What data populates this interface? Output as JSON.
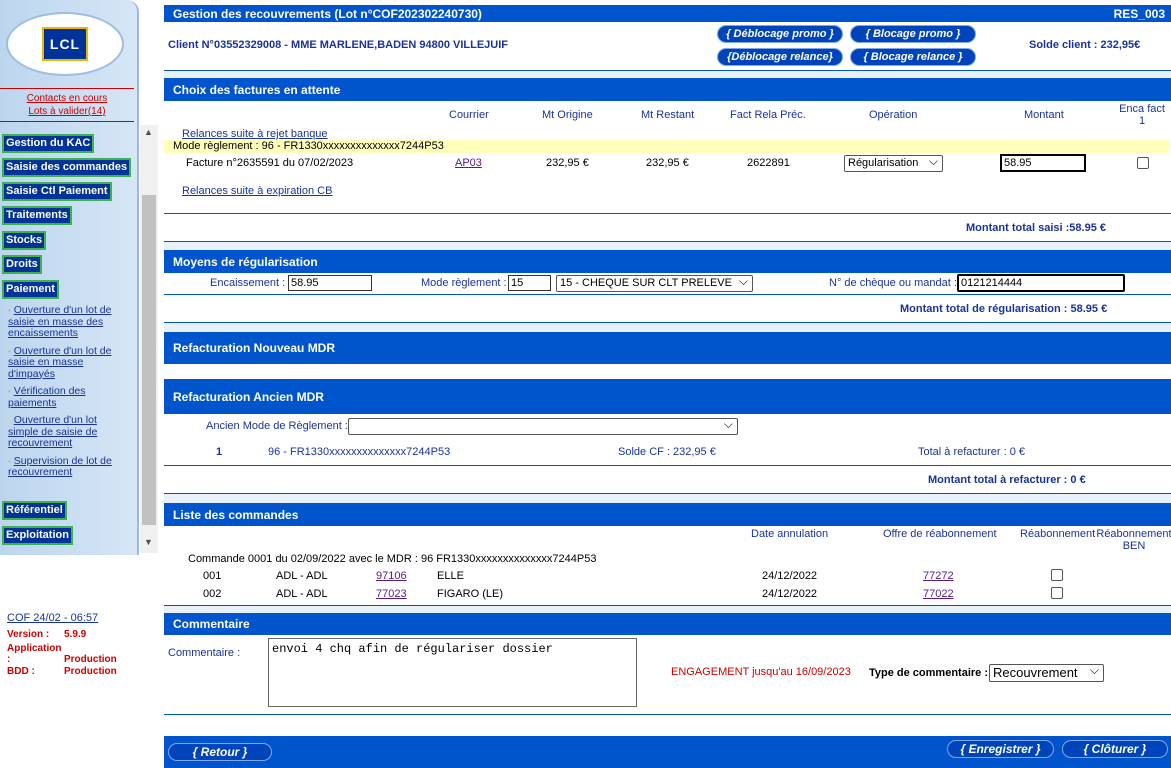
{
  "sidebar": {
    "logo": "LCL",
    "links": [
      "Contacts en cours",
      "Lots à valider(14)"
    ],
    "menus": [
      "Gestion du KAC",
      "Saisie des commandes",
      "Saisie Ctl Paiement",
      "Traitements",
      "Stocks",
      "Droits",
      "Paiement",
      "Référentiel",
      "Exploitation"
    ],
    "sublinks": [
      "Ouverture d'un lot de saisie en masse des encaissements",
      "Ouverture d'un lot de saisie en masse d'impayés",
      "Vérification des paiements",
      "Ouverture d'un lot simple de saisie de recouvrement",
      "Supervision de lot de recouvrement"
    ],
    "session": "COF 24/02 - 06:57",
    "version_label": "Version :",
    "version": "5.9.9",
    "app_label": "Application :",
    "app": "Production",
    "bdd_label": "BDD :",
    "bdd": "Production"
  },
  "header": {
    "title": "Gestion des recouvrements (Lot n°COF202302240730)",
    "code": "RES_003",
    "client": "Client N°03552329008 - MME MARLENE,BADEN 94800 VILLEJUIF",
    "btn_deblocage_promo": "{ Déblocage promo }",
    "btn_blocage_promo": "{ Blocage promo }",
    "btn_deblocage_relance": "{Déblocage relance}",
    "btn_blocage_relance": "{ Blocage relance }",
    "solde": "Solde client : 232,95€"
  },
  "factures": {
    "title": "Choix des factures en attente",
    "headers": {
      "courrier": "Courrier",
      "mt_origine": "Mt Origine",
      "mt_restant": "Mt Restant",
      "fact_rela": "Fact Rela Préc.",
      "operation": "Opération",
      "montant": "Montant",
      "enca": "Enca fact 1"
    },
    "relance_rejet": "Relances suite à rejet banque",
    "mode_reglement": "Mode règlement : 96 - FR1330xxxxxxxxxxxxxx7244P53",
    "row": {
      "facture": "Facture n°2635591 du 07/02/2023",
      "courrier": "AP03",
      "mt_origine": "232,95 €",
      "mt_restant": "232,95 €",
      "fact_rela": "2622891",
      "operation": "Régularisation",
      "montant": "58.95"
    },
    "relance_cb": "Relances suite à expiration CB",
    "total": "Montant total saisi :58.95 €"
  },
  "moyens": {
    "title": "Moyens de régularisation",
    "encaissement_label": "Encaissement :",
    "encaissement": "58.95",
    "mode_label": "Mode règlement :",
    "mode_code": "15",
    "mode_select": "15 - CHEQUE SUR CLT PRELEVE",
    "cheque_label": "N° de chèque ou mandat :",
    "cheque": "0121214444",
    "total": "Montant total de régularisation : 58.95 €"
  },
  "refact_nouveau": {
    "title": "Refacturation Nouveau MDR"
  },
  "refact_ancien": {
    "title": "Refacturation Ancien MDR",
    "ancien_label": "Ancien Mode de Règlement :",
    "ancien_value": "",
    "row_num": "1",
    "row_mdr": "96 - FR1330xxxxxxxxxxxxxx7244P53",
    "solde_cf": "Solde CF : 232,95 €",
    "total_refact": "Total à refacturer : 0 €",
    "montant_total": "Montant total à refacturer : 0 €"
  },
  "commandes": {
    "title": "Liste des commandes",
    "h_date": "Date annulation",
    "h_offre": "Offre de réabonnement",
    "h_reab": "Réabonnement",
    "h_reab_ben": "Réabonnement BEN",
    "commande": "Commande 0001 du 02/09/2022 avec le MDR : 96 FR1330xxxxxxxxxxxxxx7244P53",
    "rows": [
      {
        "num": "001",
        "type": "ADL - ADL",
        "code": "97106",
        "titre": "ELLE",
        "date": "24/12/2022",
        "offre": "77272"
      },
      {
        "num": "002",
        "type": "ADL - ADL",
        "code": "77023",
        "titre": "FIGARO (LE)",
        "date": "24/12/2022",
        "offre": "77022"
      }
    ]
  },
  "commentaire": {
    "title": "Commentaire",
    "label": "Commentaire :",
    "value": "envoi 4 chq afin de régulariser dossier",
    "engagement": "ENGAGEMENT jusqu'au 16/09/2023",
    "type_label": "Type de commentaire :",
    "type_value": "Recouvrement"
  },
  "footer": {
    "retour": "{ Retour }",
    "enregistrer": "{ Enregistrer }",
    "cloturer": "{ Clôturer }"
  }
}
